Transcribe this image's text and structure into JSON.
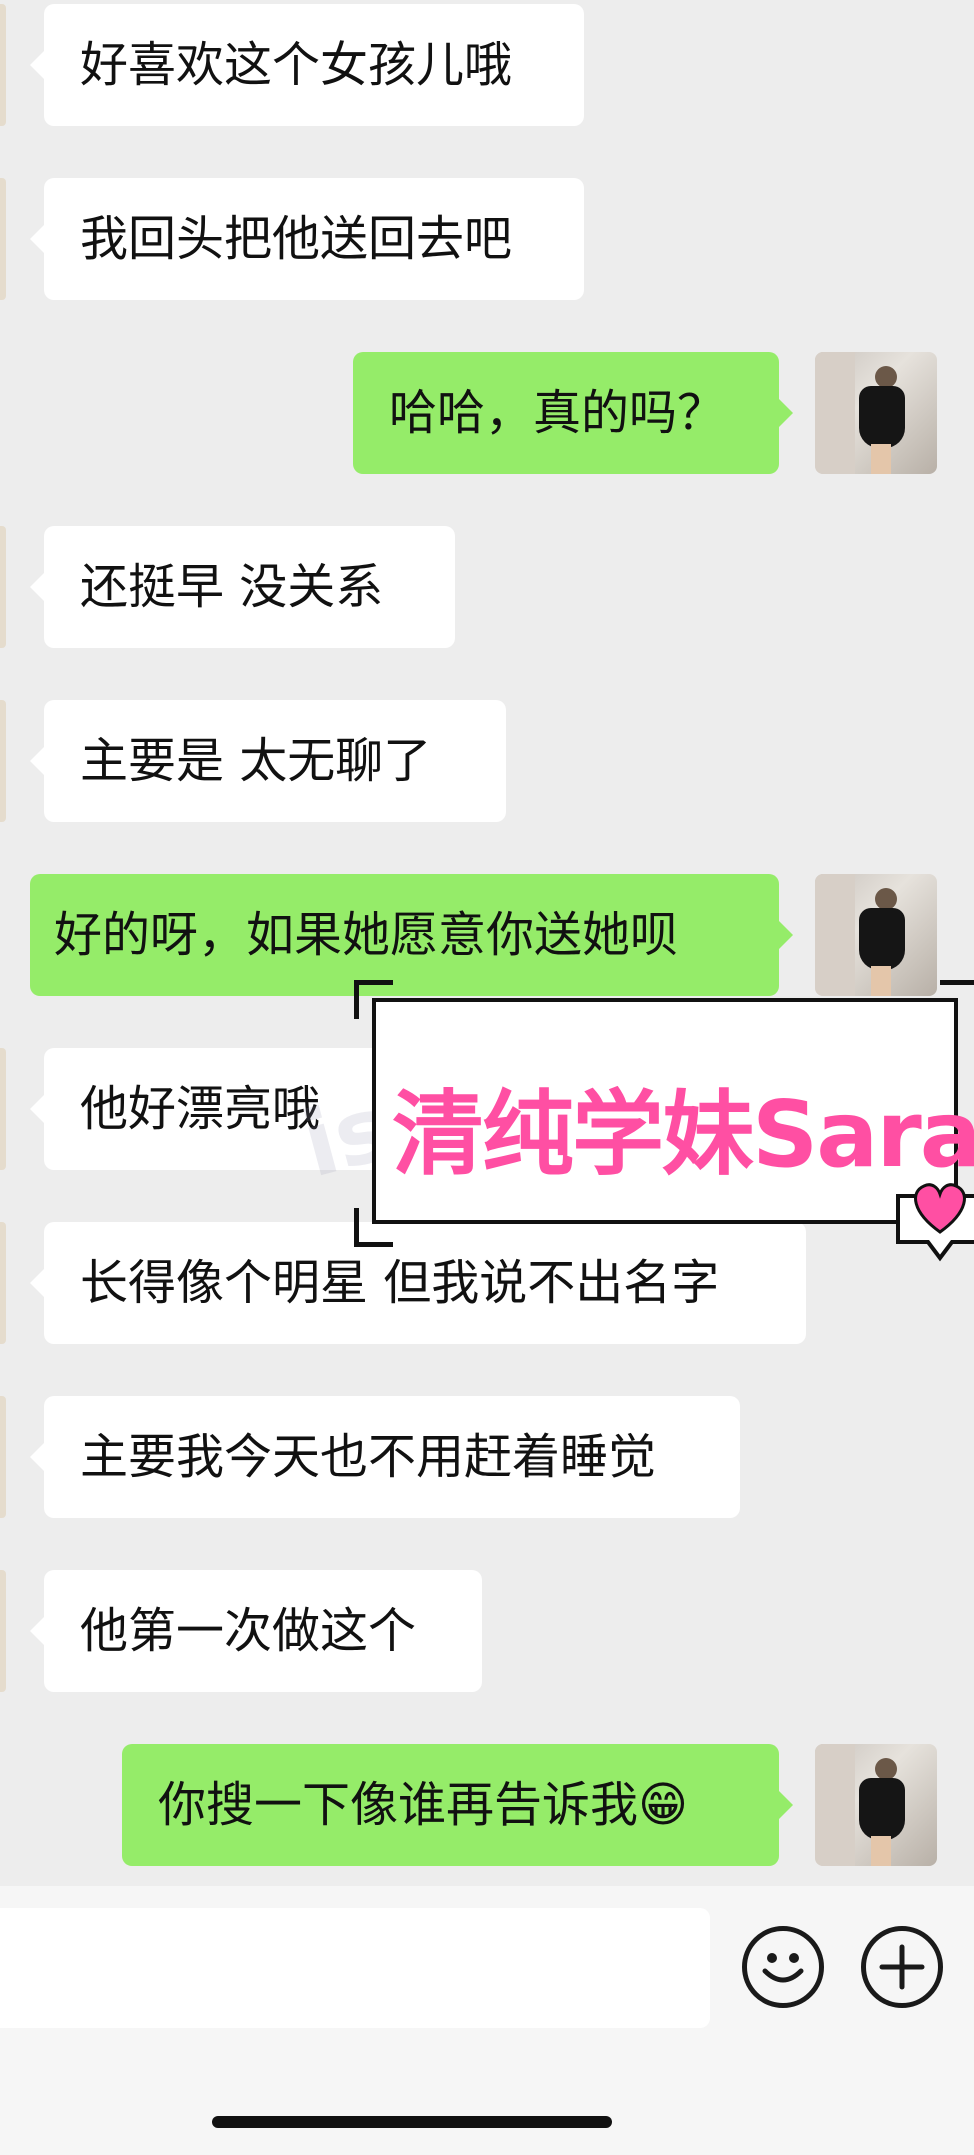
{
  "messages": [
    {
      "side": "in",
      "text": "好喜欢这个女孩儿哦"
    },
    {
      "side": "in",
      "text": "我回头把他送回去吧"
    },
    {
      "side": "out",
      "text": "哈哈，真的吗？"
    },
    {
      "side": "in",
      "text": "还挺早 没关系"
    },
    {
      "side": "in",
      "text": "主要是 太无聊了"
    },
    {
      "side": "out",
      "text": "好的呀，如果她愿意你送她呗"
    },
    {
      "side": "in",
      "text": "他好漂亮哦"
    },
    {
      "side": "in",
      "text": "长得像个明星 但我说不出名字"
    },
    {
      "side": "in",
      "text": "主要我今天也不用赶着睡觉"
    },
    {
      "side": "in",
      "text": "他第一次做这个"
    },
    {
      "side": "out",
      "text": "你搜一下像谁再告诉我😁"
    }
  ],
  "watermark": {
    "text": "清纯学妹Sara",
    "logo_text": "ishGod"
  },
  "input_bar": {
    "emoji_icon": "emoji-smile-icon",
    "plus_icon": "plus-icon"
  },
  "colors": {
    "background": "#ededed",
    "incoming_bubble": "#ffffff",
    "outgoing_bubble": "#95ec69",
    "watermark_text": "#ff4fa3"
  }
}
